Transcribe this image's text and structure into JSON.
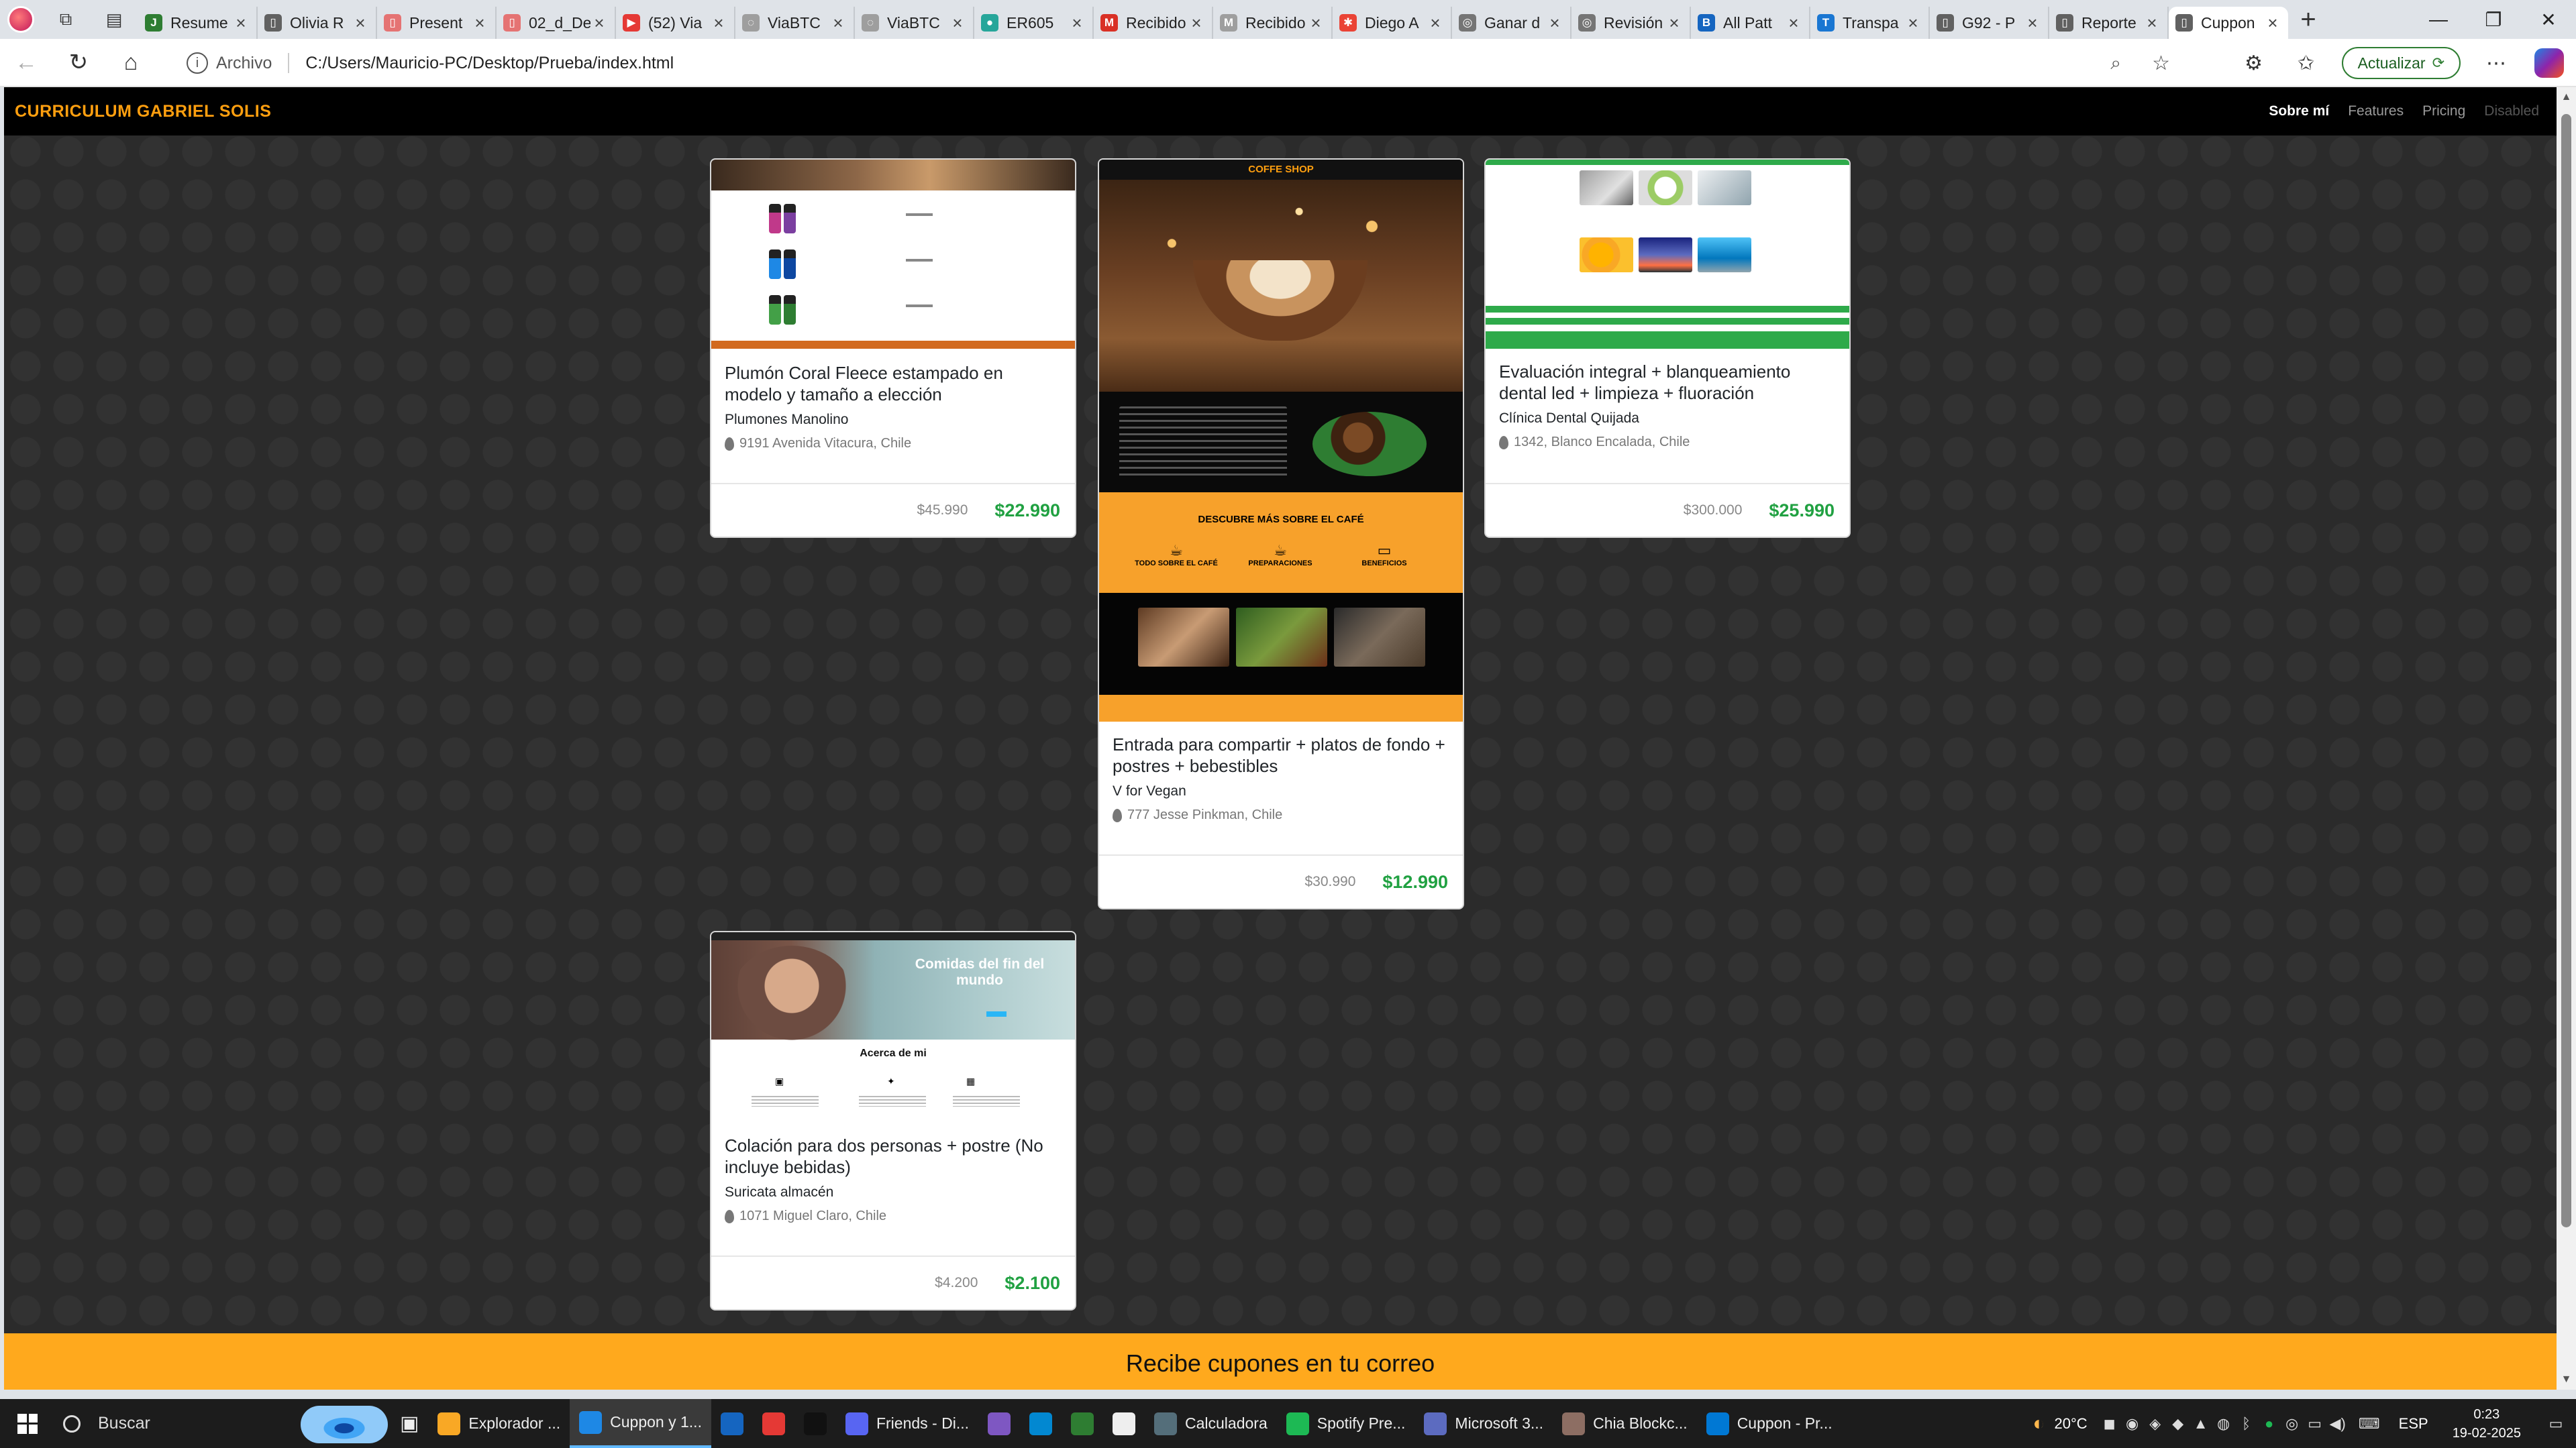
{
  "browser": {
    "tabs": [
      {
        "title": "Resume",
        "fav_color": "#2e7d32",
        "fav_text": "J"
      },
      {
        "title": "Olivia R",
        "fav_color": "#616161",
        "fav_text": "▯"
      },
      {
        "title": "Present",
        "fav_color": "#e57373",
        "fav_text": "▯"
      },
      {
        "title": "02_d_De",
        "fav_color": "#e57373",
        "fav_text": "▯"
      },
      {
        "title": "(52) Via",
        "fav_color": "#e53935",
        "fav_text": "▶"
      },
      {
        "title": "ViaBTC",
        "fav_color": "#9e9e9e",
        "fav_text": "◌"
      },
      {
        "title": "ViaBTC",
        "fav_color": "#9e9e9e",
        "fav_text": "◌"
      },
      {
        "title": "ER605",
        "fav_color": "#26a69a",
        "fav_text": "●"
      },
      {
        "title": "Recibido",
        "fav_color": "#d93025",
        "fav_text": "M"
      },
      {
        "title": "Recibido",
        "fav_color": "#9e9e9e",
        "fav_text": "M"
      },
      {
        "title": "Diego A",
        "fav_color": "#ea4335",
        "fav_text": "✱"
      },
      {
        "title": "Ganar d",
        "fav_color": "#757575",
        "fav_text": "◎"
      },
      {
        "title": "Revisión",
        "fav_color": "#757575",
        "fav_text": "◎"
      },
      {
        "title": "All Patt",
        "fav_color": "#1565c0",
        "fav_text": "B"
      },
      {
        "title": "Transpa",
        "fav_color": "#1976d2",
        "fav_text": "T"
      },
      {
        "title": "G92 - P",
        "fav_color": "#616161",
        "fav_text": "▯"
      },
      {
        "title": "Reporte",
        "fav_color": "#616161",
        "fav_text": "▯"
      },
      {
        "title": "Cuppon",
        "fav_color": "#616161",
        "fav_text": "▯",
        "active": true
      }
    ],
    "address_label": "Archivo",
    "url": "C:/Users/Mauricio-PC/Desktop/Prueba/index.html",
    "update_label": "Actualizar"
  },
  "site": {
    "brand": "CURRICULUM GABRIEL SOLIS",
    "nav": {
      "about": "Sobre mí",
      "features": "Features",
      "pricing": "Pricing",
      "disabled": "Disabled"
    },
    "cards": [
      {
        "title": "Plumón Coral Fleece estampado en modelo y tamaño a elección",
        "store": "Plumones Manolino",
        "address": "9191 Avenida Vitacura, Chile",
        "old_price": "$45.990",
        "new_price": "$22.990"
      },
      {
        "title": "Entrada para compartir + platos de fondo + postres + bebestibles",
        "store": "V for Vegan",
        "address": "777 Jesse Pinkman, Chile",
        "old_price": "$30.990",
        "new_price": "$12.990"
      },
      {
        "title": "Evaluación integral + blanqueamiento dental led + limpieza + fluoración",
        "store": "Clínica Dental Quijada",
        "address": "1342, Blanco Encalada, Chile",
        "old_price": "$300.000",
        "new_price": "$25.990"
      },
      {
        "title": "Colación para dos personas + postre (No incluye bebidas)",
        "store": "Suricata almacén",
        "address": "1071 Miguel Claro, Chile",
        "old_price": "$4.200",
        "new_price": "$2.100"
      }
    ],
    "thumb_coffee": {
      "header": "COFFE SHOP",
      "banner": "DESCUBRE MÁS SOBRE EL CAFÉ",
      "items": [
        "TODO SOBRE EL CAFÉ",
        "PREPARACIONES",
        "BENEFICIOS"
      ]
    },
    "thumb_travel": {
      "hero": "Comidas del fin del mundo",
      "section": "Acerca de mi"
    },
    "newsletter": "Recibe cupones en tu correo"
  },
  "taskbar": {
    "search_placeholder": "Buscar",
    "apps": [
      {
        "label": "Explorador ...",
        "color": "#f9a825"
      },
      {
        "label": "Cuppon y 1...",
        "color": "#1e88e5",
        "active": true
      },
      {
        "label": "",
        "color": "#1565c0"
      },
      {
        "label": "",
        "color": "#e53935"
      },
      {
        "label": "",
        "color": "#111111"
      },
      {
        "label": "Friends - Di...",
        "color": "#5865f2"
      },
      {
        "label": "",
        "color": "#7e57c2"
      },
      {
        "label": "",
        "color": "#0288d1"
      },
      {
        "label": "",
        "color": "#2e7d32"
      },
      {
        "label": "",
        "color": "#eeeeee"
      },
      {
        "label": "Calculadora",
        "color": "#546e7a"
      },
      {
        "label": "Spotify Pre...",
        "color": "#1db954"
      },
      {
        "label": "Microsoft 3...",
        "color": "#5c6bc0"
      },
      {
        "label": "Chia Blockc...",
        "color": "#8d6e63"
      },
      {
        "label": "Cuppon - Pr...",
        "color": "#0078d4"
      }
    ],
    "weather": "20°C",
    "language": "ESP",
    "time": "0:23",
    "date": "19-02-2025"
  }
}
